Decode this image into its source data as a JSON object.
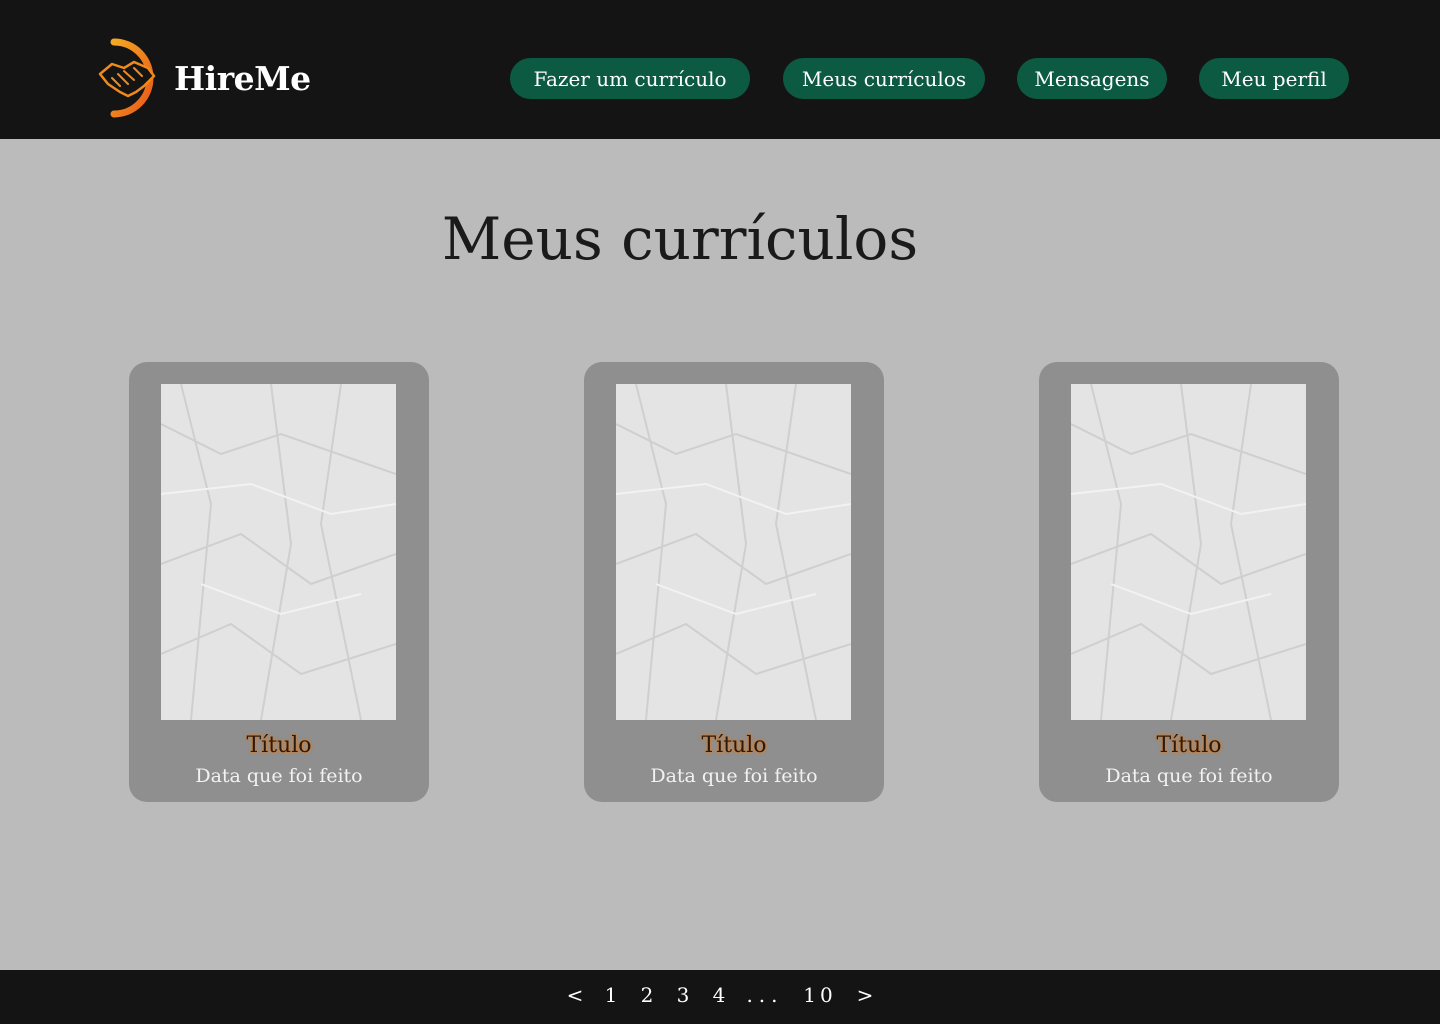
{
  "header": {
    "brand": "HireMe",
    "nav": [
      {
        "label": "Fazer um currículo"
      },
      {
        "label": "Meus currículos"
      },
      {
        "label": "Mensagens"
      },
      {
        "label": "Meu perfil"
      }
    ]
  },
  "main": {
    "title": "Meus currículos",
    "cards": [
      {
        "title": "Título",
        "date": "Data que foi feito"
      },
      {
        "title": "Título",
        "date": "Data que foi feito"
      },
      {
        "title": "Título",
        "date": "Data que foi feito"
      }
    ]
  },
  "pagination": {
    "prev": "<",
    "pages": [
      "1",
      "2",
      "3",
      "4"
    ],
    "ellipsis": "...",
    "last": "10",
    "next": ">"
  },
  "colors": {
    "header_bg": "#141414",
    "page_bg": "#bbbbbb",
    "nav_button": "#0d5a42",
    "card_bg": "#8f8f8f",
    "logo_accent": "#f08a1c"
  },
  "icons": {
    "logo": "handshake-icon"
  }
}
